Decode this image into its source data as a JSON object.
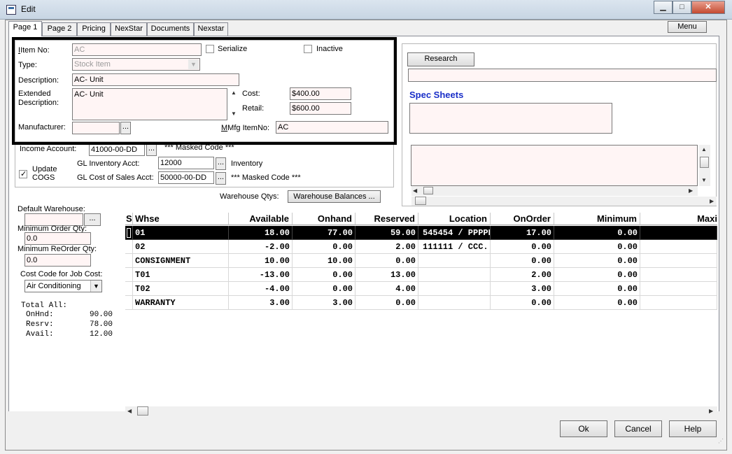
{
  "window": {
    "title": "Edit",
    "min": "0",
    "max": "1",
    "close": "r"
  },
  "tabs": [
    "Page 1",
    "Page 2",
    "Pricing",
    "NexStar",
    "Documents",
    "Nexstar"
  ],
  "menu_label": "Menu",
  "item": {
    "item_no_label": "Item No:",
    "item_no": "AC",
    "serialize_label": "Serialize",
    "inactive_label": "Inactive",
    "type_label": "Type:",
    "type_value": "Stock Item",
    "description_label": "Description:",
    "description": "AC- Unit",
    "ext_desc_label_1": "Extended",
    "ext_desc_label_2": "Description:",
    "ext_desc": "AC- Unit",
    "cost_label": "Cost:",
    "cost": "$400.00",
    "retail_label": "Retail:",
    "retail": "$600.00",
    "manufacturer_label": "Manufacturer:",
    "manufacturer": "",
    "mfg_item_label": "Mfg ItemNo:",
    "mfg_item": "AC"
  },
  "accounts": {
    "income_label": "Income Account:",
    "income": "41000-00-DD",
    "income_masked": "*** Masked Code ***",
    "update_cogs_1": "Update",
    "update_cogs_2": "COGS",
    "update_cogs_mark": "✓",
    "gl_inv_label": "GL Inventory Acct:",
    "gl_inv": "12000",
    "gl_inv_name": "Inventory",
    "gl_cos_label": "GL Cost of Sales Acct:",
    "gl_cos": "50000-00-DD",
    "gl_cos_masked": "*** Masked Code ***"
  },
  "warehouse": {
    "qtys_label": "Warehouse Qtys:",
    "balances_button": "Warehouse Balances ..."
  },
  "right_panel": {
    "research_button": "Research",
    "spec_sheets": "Spec Sheets"
  },
  "left": {
    "default_wh_label": "Default Warehouse:",
    "default_wh": "",
    "min_order_label": "Minimum Order Qty:",
    "min_order": "0.0",
    "min_reorder_label": "Minimum ReOrder Qty:",
    "min_reorder": "0.0",
    "cost_code_label": "Cost Code for Job Cost:",
    "cost_code": "Air Conditioning",
    "totals": {
      "title": "Total All:",
      "onhnd_label": "OnHnd:",
      "onhnd": "90.00",
      "resrv_label": "Resrv:",
      "resrv": "78.00",
      "avail_label": "Avail:",
      "avail": "12.00"
    }
  },
  "grid": {
    "columns": [
      "S",
      "Whse",
      "Available",
      "Onhand",
      "Reserved",
      "Location",
      "OnOrder",
      "Minimum",
      "Maxi"
    ],
    "rows": [
      [
        "",
        "01",
        "18.00",
        "77.00",
        "59.00",
        "545454 / PPPPP",
        "17.00",
        "0.00"
      ],
      [
        "",
        "02",
        "-2.00",
        "0.00",
        "2.00",
        "111111 / CCC...",
        "0.00",
        "0.00"
      ],
      [
        "",
        "CONSIGNMENT",
        "10.00",
        "10.00",
        "0.00",
        "",
        "0.00",
        "0.00"
      ],
      [
        "",
        "T01",
        "-13.00",
        "0.00",
        "13.00",
        "",
        "2.00",
        "0.00"
      ],
      [
        "",
        "T02",
        "-4.00",
        "0.00",
        "4.00",
        "",
        "3.00",
        "0.00"
      ],
      [
        "",
        "WARRANTY",
        "3.00",
        "3.00",
        "0.00",
        "",
        "0.00",
        "0.00"
      ]
    ]
  },
  "footer": {
    "ok": "Ok",
    "cancel": "Cancel",
    "help": "Help"
  },
  "icons": {
    "dropdown": "chevron-down-icon",
    "ellipsis": "..."
  }
}
